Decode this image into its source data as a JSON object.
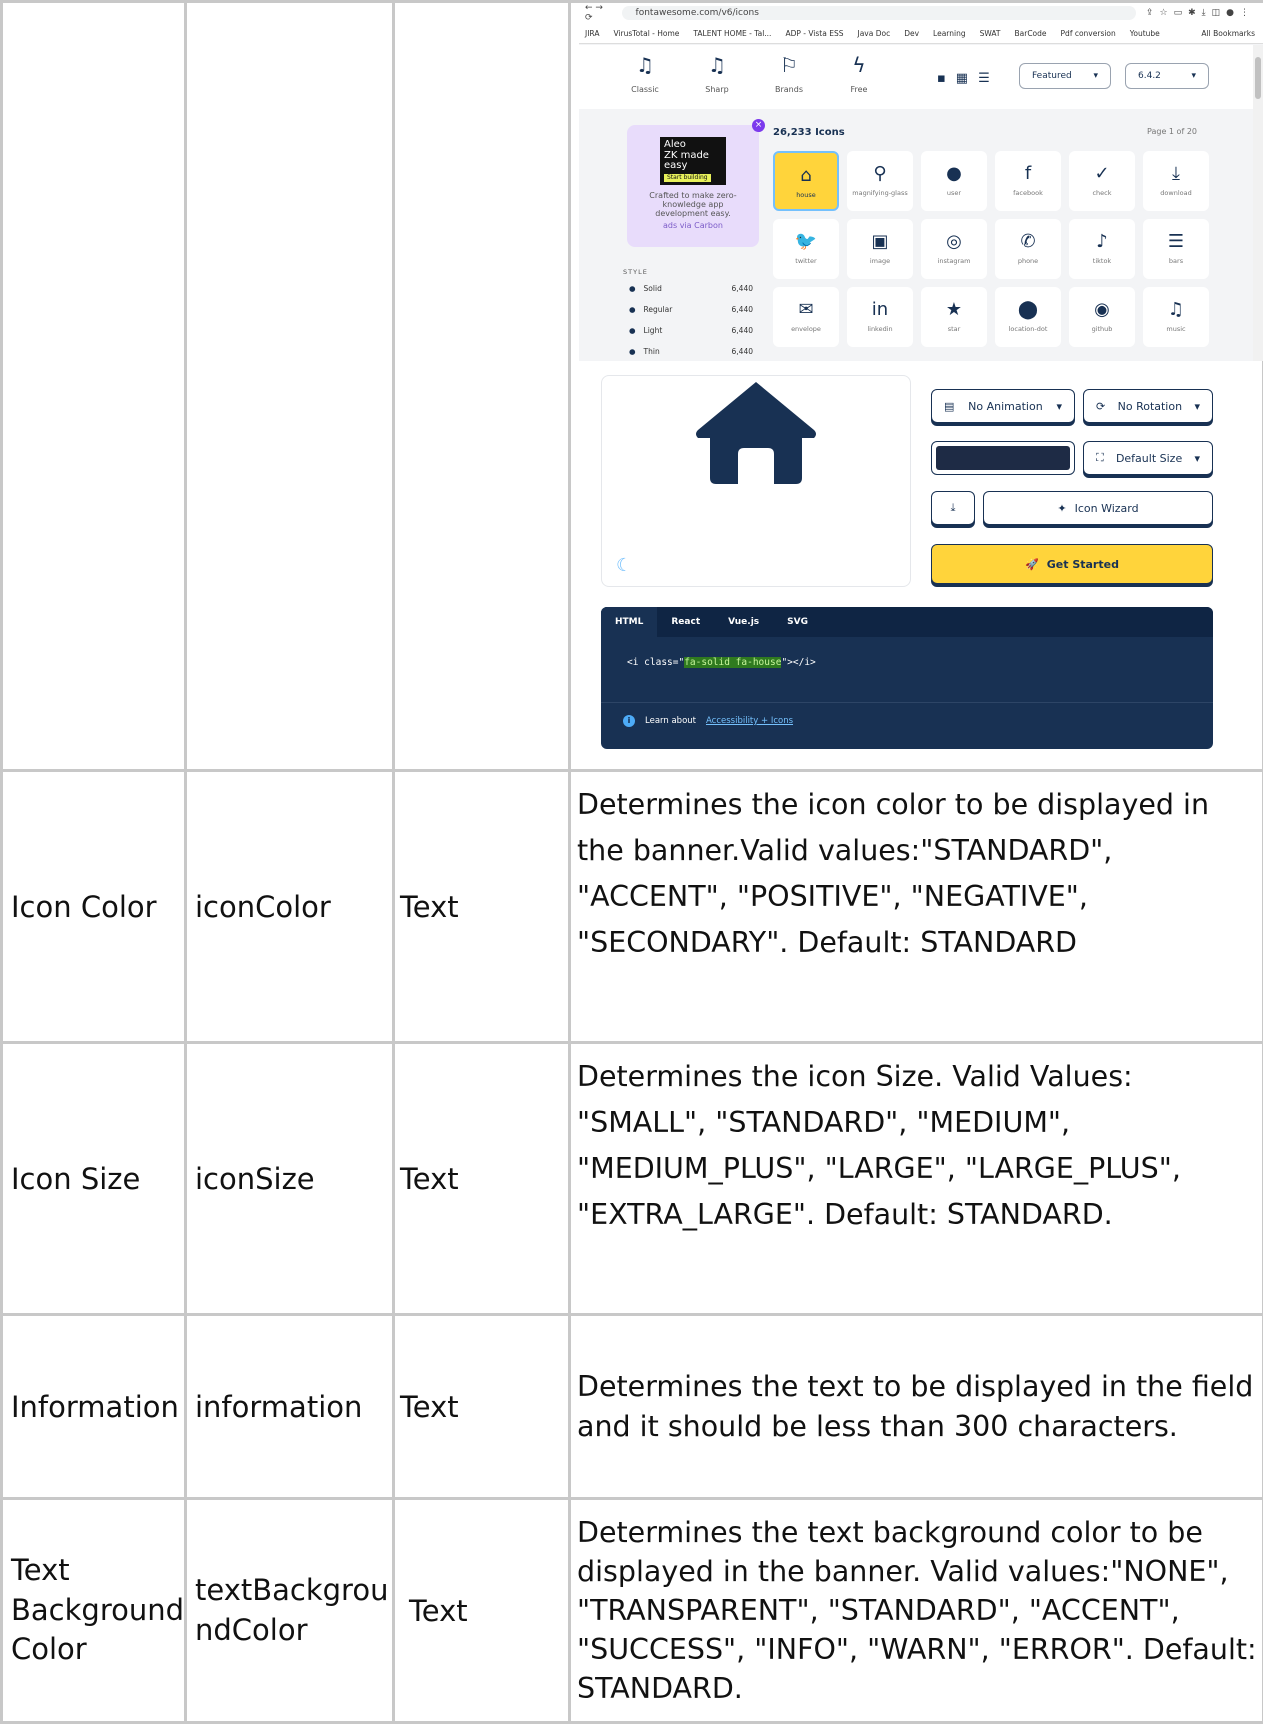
{
  "browser": {
    "url": "fontawesome.com/v6/icons",
    "bookmarks": [
      "JIRA",
      "VirusTotal - Home",
      "TALENT HOME - Tal...",
      "ADP - Vista ESS",
      "Java Doc",
      "Dev",
      "Learning",
      "SWAT",
      "BarCode",
      "Pdf conversion",
      "Youtube"
    ],
    "all_bookmarks": "All Bookmarks"
  },
  "fa": {
    "styles": [
      "Classic",
      "Sharp",
      "Brands",
      "Free"
    ],
    "sort": "Featured",
    "version": "6.4.2",
    "ad": {
      "logo_lines": [
        "Aleo",
        "ZK made",
        "easy"
      ],
      "logo_button": "Start building",
      "text": "Crafted to make zero-knowledge app development easy.",
      "via": "ads via Carbon"
    },
    "style_heading": "STYLE",
    "style_rows": [
      {
        "name": "Solid",
        "count": "6,440"
      },
      {
        "name": "Regular",
        "count": "6,440"
      },
      {
        "name": "Light",
        "count": "6,440"
      },
      {
        "name": "Thin",
        "count": "6,440"
      }
    ],
    "icon_count": "26,233 Icons",
    "page": "Page 1 of 20",
    "icons": [
      {
        "glyph": "⌂",
        "name": "house"
      },
      {
        "glyph": "⚲",
        "name": "magnifying-glass"
      },
      {
        "glyph": "●",
        "name": "user"
      },
      {
        "glyph": "f",
        "name": "facebook"
      },
      {
        "glyph": "✓",
        "name": "check"
      },
      {
        "glyph": "⤓",
        "name": "download"
      },
      {
        "glyph": "🐦",
        "name": "twitter"
      },
      {
        "glyph": "▣",
        "name": "image"
      },
      {
        "glyph": "◎",
        "name": "instagram"
      },
      {
        "glyph": "✆",
        "name": "phone"
      },
      {
        "glyph": "♪",
        "name": "tiktok"
      },
      {
        "glyph": "☰",
        "name": "bars"
      },
      {
        "glyph": "✉",
        "name": "envelope"
      },
      {
        "glyph": "in",
        "name": "linkedin"
      },
      {
        "glyph": "★",
        "name": "star"
      },
      {
        "glyph": "⬤",
        "name": "location-dot"
      },
      {
        "glyph": "◉",
        "name": "github"
      },
      {
        "glyph": "♫",
        "name": "music"
      }
    ],
    "animation": "No Animation",
    "rotation": "No Rotation",
    "size": "Default Size",
    "wizard": "Icon Wizard",
    "get_started": "Get Started",
    "code_tabs": [
      "HTML",
      "React",
      "Vue.js",
      "SVG"
    ],
    "snippet_pre": "<i class=\"",
    "snippet_cls": "fa-solid fa-house",
    "snippet_post": "\"></i>",
    "learn": "Learn about",
    "learn_link": "Accessibility + Icons",
    "house_color": "#183153"
  },
  "rows": [
    {
      "name": "Icon Color",
      "key": "iconColor",
      "type": "Text",
      "desc": "Determines the icon color to be displayed in the banner.Valid values:\"STANDARD\", \"ACCENT\", \"POSITIVE\", \"NEGATIVE\", \"SECONDARY\". Default: STANDARD"
    },
    {
      "name": "Icon Size",
      "key": "iconSize",
      "type": "Text",
      "desc": "Determines the icon Size. Valid Values: \"SMALL\", \"STANDARD\", \"MEDIUM\", \"MEDIUM_PLUS\", \"LARGE\", \"LARGE_PLUS\", \"EXTRA_LARGE\". Default: STANDARD."
    },
    {
      "name": "Information",
      "key": "information",
      "type": "Text",
      "desc": "Determines the text to be displayed in the field and it should be less than 300 characters."
    },
    {
      "name": "Text Background Color",
      "key": "textBackgroundColor",
      "type": "Text",
      "desc": "Determines the text background color to be displayed in the banner. Valid values:\"NONE\", \"TRANSPARENT\", \"STANDARD\", \"ACCENT\", \"SUCCESS\", \"INFO\", \"WARN\", \"ERROR\". Default: STANDARD."
    }
  ]
}
